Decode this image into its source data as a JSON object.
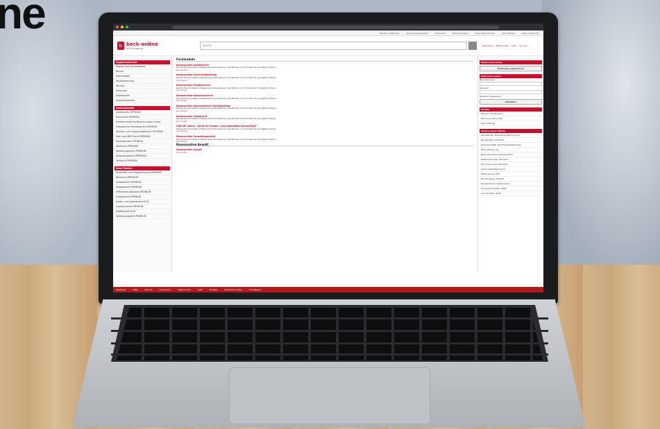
{
  "corner_text": "ne",
  "screen": {
    "top_nav": [
      "Steuern & Bilanzen",
      "beck-personal-portal",
      "beck-shop",
      "beck-akademie",
      "beck-aktionsmedia",
      "beck-aktuell",
      "beck-community"
    ],
    "logo": {
      "name": "beck-online",
      "sub": "DIE DATENBANK"
    },
    "search": {
      "placeholder": "Suche:"
    },
    "header_links": [
      "Merkzettel",
      "Mitteilungen",
      "Hilfe",
      "Service"
    ],
    "left_sections": [
      {
        "title": "Angebotsbereich",
        "items": [
          "Module nach Rechtsgebiet",
          "Bücher",
          "Zeitschriften",
          "Rechtsprechung",
          "Normen",
          "Formulare",
          "Arbeitshilfen",
          "Gesamtübersicht"
        ]
      },
      {
        "title": "Aufbaumodule",
        "items": [
          "Arbeitsrecht OPTIMUM",
          "Bilanzrecht PREMIUM",
          "Familienrechtliche Berechnungen Online",
          "Gewerblicher Rechtsschutz PREMIUM",
          "Handels- und Gesellschaftsrecht OPTIMUM",
          "Miet- und WEG-Recht PREMIUM",
          "Steuerberater OPTIMUM",
          "Strafrecht PREMIUM",
          "Verfassungsrecht PREMIUM",
          "Verwaltungsrecht PREMIUM",
          "Zivilrecht PREMIUM"
        ]
      },
      {
        "title": "Neue Module",
        "items": [
          "Ausländer- und Migrationsrecht PREMIUM",
          "Bankrecht PREMIUM",
          "Umweltrecht PREMIUM",
          "Vergaberecht PREMIUM",
          "Öffentliches Baurecht PREMIUM",
          "Energierecht PREMIUM",
          "Kinder- und Jugendrecht PLUS",
          "Insolvenzrecht OPTIMUM",
          "Arbeitsrecht PLUS",
          "Verfassungsrecht PREMIUM"
        ]
      }
    ],
    "main": {
      "heading": "Fachmodule",
      "entries": [
        {
          "title": "Nomosonline Arbeitsrecht",
          "link": "zum Inhalt"
        },
        {
          "title": "Nomosonline Erbrechtsberatung",
          "link": "zum Inhalt"
        },
        {
          "title": "Nomosonline Familienrecht",
          "link": "zum Inhalt"
        },
        {
          "title": "Nomosonline Kommunalrecht",
          "link": "zum Inhalt"
        },
        {
          "title": "Nomosonline Kommentierte Spezialgesetze",
          "link": "zum Inhalt"
        },
        {
          "title": "Nomosonline Sozialrecht",
          "link": "zum Inhalt"
        },
        {
          "title": "SGB VIII online – Recht der Kinder- und Jugendhilfe Nomos/DIJuF",
          "link": "zum Inhalt"
        },
        {
          "title": "Nomosonline Verwaltungsrecht",
          "link": "zum Inhalt"
        }
      ],
      "heading2": "Nomosonline Anwalt",
      "entries2": [
        {
          "title": "Nomosonline Anwalt",
          "link": "zum Inhalt"
        }
      ]
    },
    "right": {
      "login_title": "Meine beck-online",
      "register_btn": "Kostenlos registrieren",
      "login_section": "Mein beck-online",
      "username_label": "Benutzername",
      "password_label": "Passwort",
      "forgot": "Passwort vergessen?",
      "login_btn": "Anmelden",
      "portals_title": "Portale",
      "portals": [
        "Steuern und Bilanzen",
        "beck-personal-portal",
        "beck-stiftung"
      ],
      "news_title": "Unsere neuen Werke",
      "news": [
        "Ecker/Ruske, Bayerische Bauordnung",
        "Bareiß/Kipp, Kaufrecht",
        "Rehm/Gorbatti, Rechtsanwaltskammer",
        "Maunz/Dürig, GG",
        "Beck'sche Online-Kommentare",
        "Gablenz/Glocker, Erbrecht",
        "Böhm/Leonhard, BetrAVG",
        "Sachverständigenrecht",
        "Müller-Glöge, ErfK",
        "Korintenberg, GNotKG",
        "Ring/Grziwotz, Vereinsrecht",
        "Schönke/Schröder, StGB",
        "Lackner/Kühl, StGB"
      ]
    },
    "footer": [
      "Startseite",
      "Hilfe",
      "Service",
      "Impressum",
      "Datenschutz",
      "AGB",
      "Kontakt",
      "Feedback senden",
      "Schriftgrad"
    ]
  }
}
